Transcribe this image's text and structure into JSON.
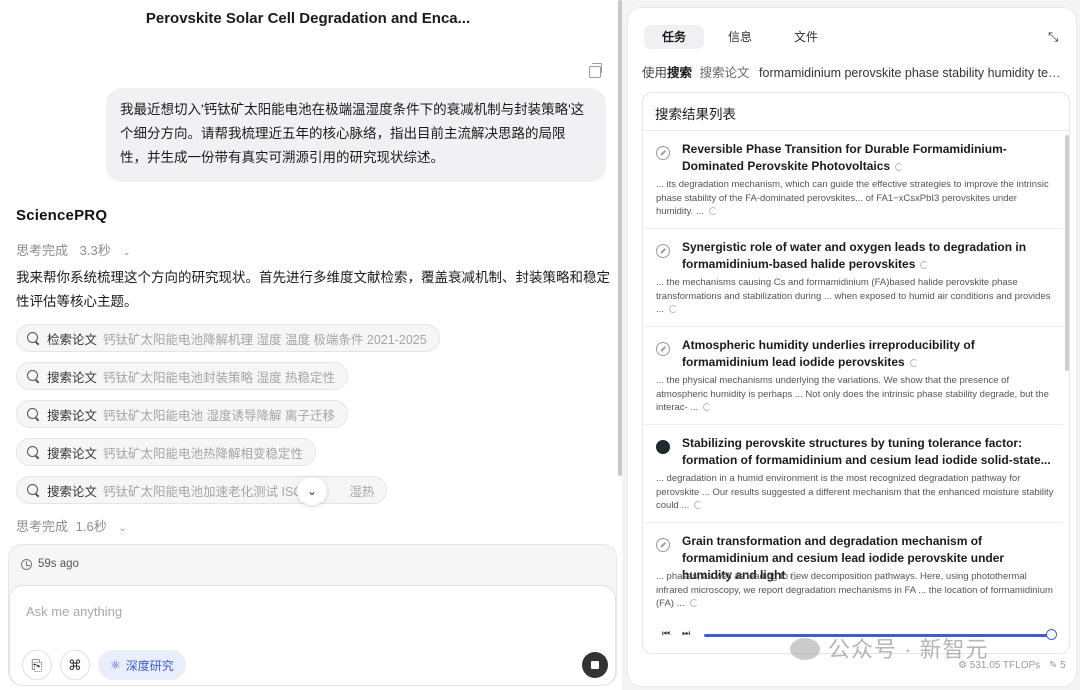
{
  "conversation": {
    "title": "Perovskite Solar Cell Degradation and Enca...",
    "user_message": "我最近想切入'钙钛矿太阳能电池在极端温湿度条件下的衰减机制与封装策略'这个细分方向。请帮我梳理近五年的核心脉络，指出目前主流解决思路的局限性，并生成一份带有真实可溯源引用的研究现状综述。",
    "logo": "SciencePRQ",
    "think_1": "思考完成",
    "think_1_time": "3.3秒",
    "answer": "我来帮你系统梳理这个方向的研究现状。首先进行多维度文献检索，覆盖衰减机制、封装策略和稳定性评估等核心主题。",
    "searches": [
      {
        "action": "检索论文",
        "query": "钙钛矿太阳能电池降解机理 湿度 温度 极端条件 2021-2025"
      },
      {
        "action": "搜索论文",
        "query": "钙钛矿太阳能电池封装策略 湿度 热稳定性"
      },
      {
        "action": "搜索论文",
        "query": "钙钛矿太阳能电池 湿度诱导降解 离子迁移"
      },
      {
        "action": "搜索论文",
        "query": "钙钛矿太阳能电池热降解相变稳定性"
      },
      {
        "action": "搜索论文",
        "query": "钙钛矿太阳能电池加速老化测试 ISOS",
        "query_tail": "湿热"
      }
    ],
    "think_2": "思考完成",
    "think_2_time": "1.6秒"
  },
  "composer": {
    "time_ago": "59s ago",
    "placeholder": "Ask me anything",
    "deep_research_label": "深度研究"
  },
  "panel": {
    "tabs": [
      "任务",
      "信息",
      "文件"
    ],
    "active_tab": "任务",
    "using_prefix": "使用",
    "using_tool": "搜索",
    "using_label": "搜索论文",
    "using_query": "formamidinium perovskite phase stability humidity temperature degradation",
    "results_header": "搜索结果列表",
    "results": [
      {
        "title": "Reversible Phase Transition for Durable Formamidinium-Dominated Perovskite Photovoltaics",
        "snippet": "... its degradation mechanism, which can guide the effective strategies to improve the intrinsic phase stability of the FA-dominated perovskites... of FA1−xCsxPbI3 perovskites under humidity. ...",
        "icon": "link-icon"
      },
      {
        "title": "Synergistic role of water and oxygen leads to degradation in formamidinium-based halide perovskites",
        "snippet": "... the mechanisms causing Cs and formamidinium (FA)based halide perovskite phase transformations and stabilization during ... when exposed to humid air conditions and provides ...",
        "icon": "link-icon"
      },
      {
        "title": "Atmospheric humidity underlies irreproducibility of formamidinium lead iodide perovskites",
        "snippet": "... the physical mechanisms underlying the variations. We show that the presence of atmospheric humidity is perhaps ... Not only does the intrinsic phase stability degrade, but the interac- ...",
        "icon": "link-icon"
      },
      {
        "title": "Stabilizing perovskite structures by tuning tolerance factor: formation of formamidinium and cesium lead iodide solid-state...",
        "snippet": "... degradation in a humid environment is the most recognized degradation pathway for perovskite ... Our results suggested a different mechanism that the enhanced moisture stability could ...",
        "icon": "site-logo-icon"
      },
      {
        "title": "Grain transformation and degradation mechanism of formamidinium and cesium lead iodide perovskite under humidity and light",
        "snippet": "... phases, as well as leading to new decomposition pathways. Here, using photothermal infrared microscopy, we report degradation mechanisms in FA ... the location of formamidinium (FA) ...",
        "icon": "link-icon"
      }
    ],
    "playback_progress": 1.0,
    "tflops": "531.05 TFLOPs",
    "tflops_extra": "5"
  },
  "watermark": "公众号 · 新智元"
}
